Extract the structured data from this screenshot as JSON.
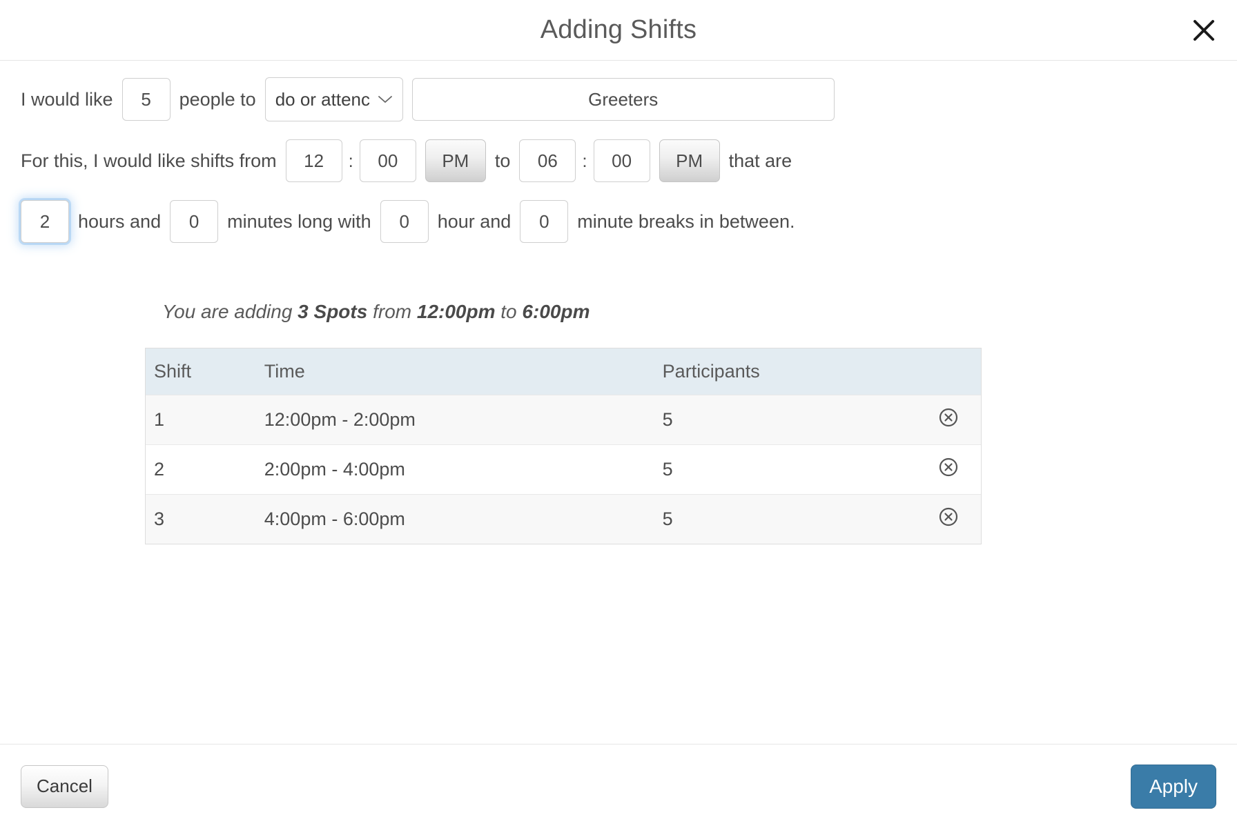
{
  "header": {
    "title": "Adding Shifts",
    "close_icon": "close-icon"
  },
  "form": {
    "row1": {
      "prefix_text": "I would like",
      "people_count": "5",
      "mid_text": "people to",
      "activity_select_value": "do or attenc",
      "activity_select_icon": "chevron-down-icon",
      "activity_name": "Greeters"
    },
    "row2": {
      "prefix_text": "For this, I would like shifts from",
      "start_hour": "12",
      "start_minute": "00",
      "start_meridiem": "PM",
      "middle_text": "to",
      "end_hour": "06",
      "end_minute": "00",
      "end_meridiem": "PM",
      "suffix_text": "that are",
      "colon": ":"
    },
    "row3": {
      "duration_hours": "2",
      "hours_label": "hours and",
      "duration_minutes": "0",
      "minutes_label": "minutes long with",
      "break_hours": "0",
      "break_hours_label": "hour and",
      "break_minutes": "0",
      "break_minutes_label": "minute breaks in between."
    }
  },
  "summary": {
    "part1": "You are adding ",
    "spots": "3 Spots",
    "part2": " from ",
    "start_time": "12:00pm",
    "part3": " to ",
    "end_time": "6:00pm"
  },
  "table": {
    "columns": [
      "Shift",
      "Time",
      "Participants",
      ""
    ],
    "rows": [
      {
        "shift": "1",
        "time": "12:00pm - 2:00pm",
        "participants": "5",
        "delete_icon": "delete-circle-icon"
      },
      {
        "shift": "2",
        "time": "2:00pm - 4:00pm",
        "participants": "5",
        "delete_icon": "delete-circle-icon"
      },
      {
        "shift": "3",
        "time": "4:00pm - 6:00pm",
        "participants": "5",
        "delete_icon": "delete-circle-icon"
      }
    ]
  },
  "footer": {
    "cancel_label": "Cancel",
    "apply_label": "Apply"
  },
  "colors": {
    "apply_blue": "#3a7ca8",
    "table_header_blue": "#e3ecf2",
    "row_alt_gray": "#f8f8f8",
    "text_gray": "#4c4c4c",
    "focus_glow_blue": "#8cbef0"
  }
}
